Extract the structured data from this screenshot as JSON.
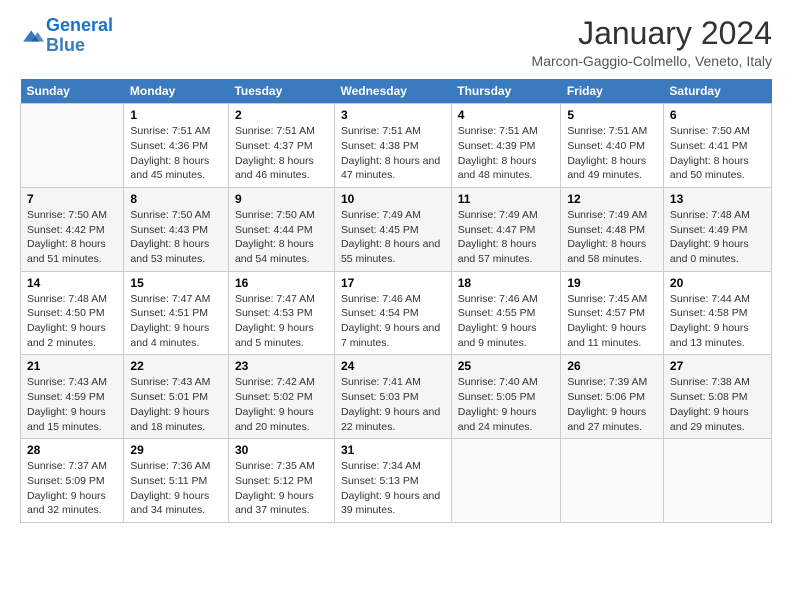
{
  "logo": {
    "line1": "General",
    "line2": "Blue"
  },
  "title": "January 2024",
  "subtitle": "Marcon-Gaggio-Colmello, Veneto, Italy",
  "days_of_week": [
    "Sunday",
    "Monday",
    "Tuesday",
    "Wednesday",
    "Thursday",
    "Friday",
    "Saturday"
  ],
  "weeks": [
    [
      {
        "day": "",
        "sunrise": "",
        "sunset": "",
        "daylight": ""
      },
      {
        "day": "1",
        "sunrise": "Sunrise: 7:51 AM",
        "sunset": "Sunset: 4:36 PM",
        "daylight": "Daylight: 8 hours and 45 minutes."
      },
      {
        "day": "2",
        "sunrise": "Sunrise: 7:51 AM",
        "sunset": "Sunset: 4:37 PM",
        "daylight": "Daylight: 8 hours and 46 minutes."
      },
      {
        "day": "3",
        "sunrise": "Sunrise: 7:51 AM",
        "sunset": "Sunset: 4:38 PM",
        "daylight": "Daylight: 8 hours and 47 minutes."
      },
      {
        "day": "4",
        "sunrise": "Sunrise: 7:51 AM",
        "sunset": "Sunset: 4:39 PM",
        "daylight": "Daylight: 8 hours and 48 minutes."
      },
      {
        "day": "5",
        "sunrise": "Sunrise: 7:51 AM",
        "sunset": "Sunset: 4:40 PM",
        "daylight": "Daylight: 8 hours and 49 minutes."
      },
      {
        "day": "6",
        "sunrise": "Sunrise: 7:50 AM",
        "sunset": "Sunset: 4:41 PM",
        "daylight": "Daylight: 8 hours and 50 minutes."
      }
    ],
    [
      {
        "day": "7",
        "sunrise": "Sunrise: 7:50 AM",
        "sunset": "Sunset: 4:42 PM",
        "daylight": "Daylight: 8 hours and 51 minutes."
      },
      {
        "day": "8",
        "sunrise": "Sunrise: 7:50 AM",
        "sunset": "Sunset: 4:43 PM",
        "daylight": "Daylight: 8 hours and 53 minutes."
      },
      {
        "day": "9",
        "sunrise": "Sunrise: 7:50 AM",
        "sunset": "Sunset: 4:44 PM",
        "daylight": "Daylight: 8 hours and 54 minutes."
      },
      {
        "day": "10",
        "sunrise": "Sunrise: 7:49 AM",
        "sunset": "Sunset: 4:45 PM",
        "daylight": "Daylight: 8 hours and 55 minutes."
      },
      {
        "day": "11",
        "sunrise": "Sunrise: 7:49 AM",
        "sunset": "Sunset: 4:47 PM",
        "daylight": "Daylight: 8 hours and 57 minutes."
      },
      {
        "day": "12",
        "sunrise": "Sunrise: 7:49 AM",
        "sunset": "Sunset: 4:48 PM",
        "daylight": "Daylight: 8 hours and 58 minutes."
      },
      {
        "day": "13",
        "sunrise": "Sunrise: 7:48 AM",
        "sunset": "Sunset: 4:49 PM",
        "daylight": "Daylight: 9 hours and 0 minutes."
      }
    ],
    [
      {
        "day": "14",
        "sunrise": "Sunrise: 7:48 AM",
        "sunset": "Sunset: 4:50 PM",
        "daylight": "Daylight: 9 hours and 2 minutes."
      },
      {
        "day": "15",
        "sunrise": "Sunrise: 7:47 AM",
        "sunset": "Sunset: 4:51 PM",
        "daylight": "Daylight: 9 hours and 4 minutes."
      },
      {
        "day": "16",
        "sunrise": "Sunrise: 7:47 AM",
        "sunset": "Sunset: 4:53 PM",
        "daylight": "Daylight: 9 hours and 5 minutes."
      },
      {
        "day": "17",
        "sunrise": "Sunrise: 7:46 AM",
        "sunset": "Sunset: 4:54 PM",
        "daylight": "Daylight: 9 hours and 7 minutes."
      },
      {
        "day": "18",
        "sunrise": "Sunrise: 7:46 AM",
        "sunset": "Sunset: 4:55 PM",
        "daylight": "Daylight: 9 hours and 9 minutes."
      },
      {
        "day": "19",
        "sunrise": "Sunrise: 7:45 AM",
        "sunset": "Sunset: 4:57 PM",
        "daylight": "Daylight: 9 hours and 11 minutes."
      },
      {
        "day": "20",
        "sunrise": "Sunrise: 7:44 AM",
        "sunset": "Sunset: 4:58 PM",
        "daylight": "Daylight: 9 hours and 13 minutes."
      }
    ],
    [
      {
        "day": "21",
        "sunrise": "Sunrise: 7:43 AM",
        "sunset": "Sunset: 4:59 PM",
        "daylight": "Daylight: 9 hours and 15 minutes."
      },
      {
        "day": "22",
        "sunrise": "Sunrise: 7:43 AM",
        "sunset": "Sunset: 5:01 PM",
        "daylight": "Daylight: 9 hours and 18 minutes."
      },
      {
        "day": "23",
        "sunrise": "Sunrise: 7:42 AM",
        "sunset": "Sunset: 5:02 PM",
        "daylight": "Daylight: 9 hours and 20 minutes."
      },
      {
        "day": "24",
        "sunrise": "Sunrise: 7:41 AM",
        "sunset": "Sunset: 5:03 PM",
        "daylight": "Daylight: 9 hours and 22 minutes."
      },
      {
        "day": "25",
        "sunrise": "Sunrise: 7:40 AM",
        "sunset": "Sunset: 5:05 PM",
        "daylight": "Daylight: 9 hours and 24 minutes."
      },
      {
        "day": "26",
        "sunrise": "Sunrise: 7:39 AM",
        "sunset": "Sunset: 5:06 PM",
        "daylight": "Daylight: 9 hours and 27 minutes."
      },
      {
        "day": "27",
        "sunrise": "Sunrise: 7:38 AM",
        "sunset": "Sunset: 5:08 PM",
        "daylight": "Daylight: 9 hours and 29 minutes."
      }
    ],
    [
      {
        "day": "28",
        "sunrise": "Sunrise: 7:37 AM",
        "sunset": "Sunset: 5:09 PM",
        "daylight": "Daylight: 9 hours and 32 minutes."
      },
      {
        "day": "29",
        "sunrise": "Sunrise: 7:36 AM",
        "sunset": "Sunset: 5:11 PM",
        "daylight": "Daylight: 9 hours and 34 minutes."
      },
      {
        "day": "30",
        "sunrise": "Sunrise: 7:35 AM",
        "sunset": "Sunset: 5:12 PM",
        "daylight": "Daylight: 9 hours and 37 minutes."
      },
      {
        "day": "31",
        "sunrise": "Sunrise: 7:34 AM",
        "sunset": "Sunset: 5:13 PM",
        "daylight": "Daylight: 9 hours and 39 minutes."
      },
      {
        "day": "",
        "sunrise": "",
        "sunset": "",
        "daylight": ""
      },
      {
        "day": "",
        "sunrise": "",
        "sunset": "",
        "daylight": ""
      },
      {
        "day": "",
        "sunrise": "",
        "sunset": "",
        "daylight": ""
      }
    ]
  ]
}
